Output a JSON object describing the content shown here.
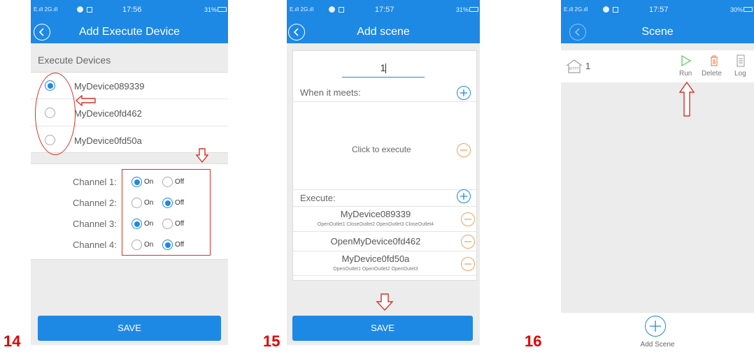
{
  "status": {
    "signal": "E.ıll 2G.ıll",
    "battery_a": "31%",
    "battery_b": "30%",
    "time_a": "17:56",
    "time_b": "17:57"
  },
  "steps": [
    "14",
    "15",
    "16"
  ],
  "screen14": {
    "title": "Add Execute Device",
    "section_label": "Execute Devices",
    "devices": [
      {
        "name": "MyDevice089339",
        "selected": true
      },
      {
        "name": "MyDevice0fd462",
        "selected": false
      },
      {
        "name": "MyDevice0fd50a",
        "selected": false
      }
    ],
    "channels": [
      {
        "label": "Channel 1:",
        "state": "On"
      },
      {
        "label": "Channel 2:",
        "state": "Off"
      },
      {
        "label": "Channel 3:",
        "state": "On"
      },
      {
        "label": "Channel 4:",
        "state": "Off"
      }
    ],
    "on_label": "On",
    "off_label": "Off",
    "save_label": "SAVE"
  },
  "screen15": {
    "title": "Add scene",
    "scene_name_value": "1",
    "when_label": "When it meets:",
    "click_execute": "Click to execute",
    "execute_label": "Execute:",
    "execute_items": [
      {
        "name": "MyDevice089339",
        "detail": "OpenOutlet1 CloseOutlet2 OpenOutlet3 CloseOutlet4"
      },
      {
        "name": "OpenMyDevice0fd462",
        "detail": ""
      },
      {
        "name": "MyDevice0fd50a",
        "detail": "OpenOutlet1 OpenOutlet2 OpenOutet3"
      }
    ],
    "save_label": "SAVE"
  },
  "screen16": {
    "title": "Scene",
    "scene_badge": "IFTTT",
    "scene_name": "1",
    "run_label": "Run",
    "delete_label": "Delete",
    "log_label": "Log",
    "add_label": "Add Scene"
  },
  "colors": {
    "primary": "#1e88e5",
    "annotation_red": "#d9302a",
    "minus_orange": "#f0a060",
    "run_green": "#5cc45c",
    "delete_orange": "#f07030"
  }
}
